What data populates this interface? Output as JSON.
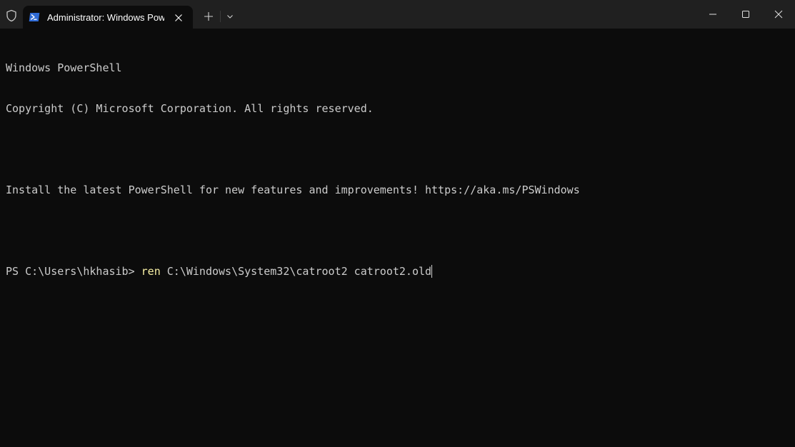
{
  "window": {
    "tab_title": "Administrator: Windows PowerShell",
    "icons": {
      "shield": "shield-icon",
      "tab": "powershell-icon",
      "close_tab": "close-icon",
      "new_tab": "plus-icon",
      "dropdown": "chevron-down-icon",
      "minimize": "minimize-icon",
      "maximize": "maximize-icon",
      "close": "close-icon"
    }
  },
  "terminal": {
    "banner_line1": "Windows PowerShell",
    "banner_line2": "Copyright (C) Microsoft Corporation. All rights reserved.",
    "install_message": "Install the latest PowerShell for new features and improvements! https://aka.ms/PSWindows",
    "prompt": "PS C:\\Users\\hkhasib> ",
    "command": "ren",
    "arguments": " C:\\Windows\\System32\\catroot2 catroot2.old"
  },
  "colors": {
    "background": "#0c0c0c",
    "titlebar": "#202020",
    "text": "#cccccc",
    "command": "#f9f1a5",
    "powershell_blue": "#2f6bd6"
  }
}
